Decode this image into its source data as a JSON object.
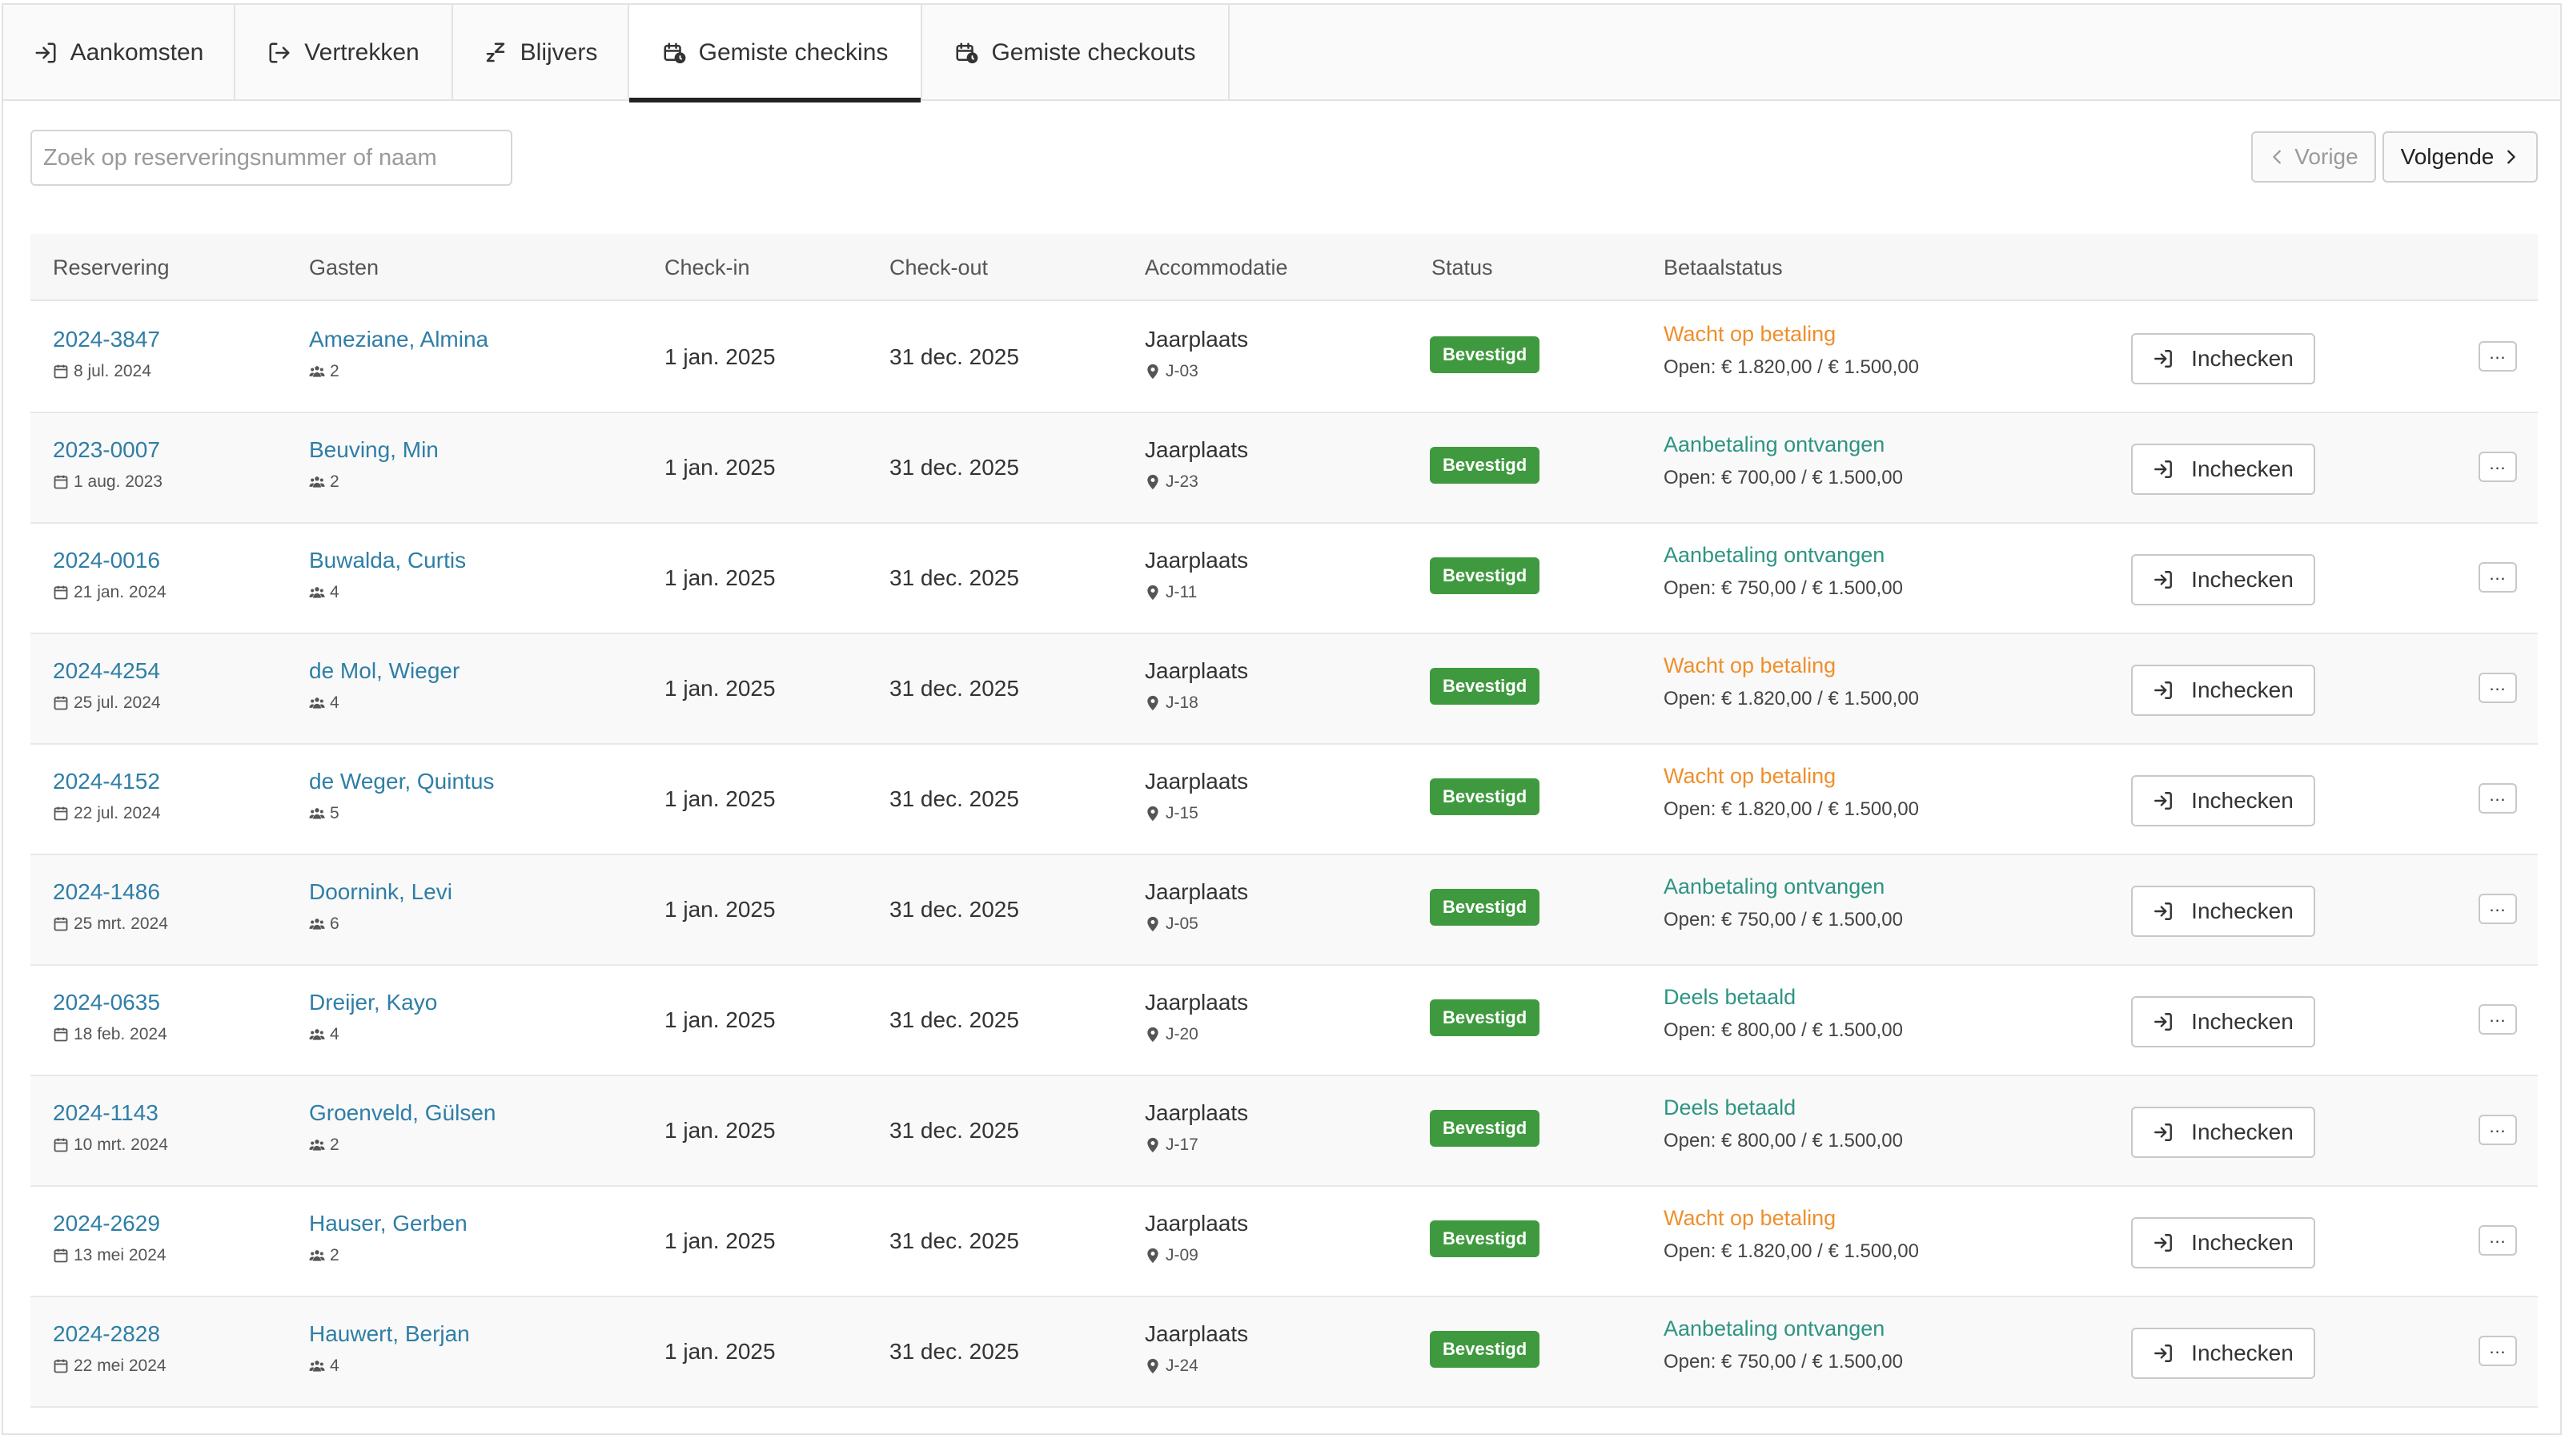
{
  "tabs": [
    {
      "label": "Aankomsten",
      "icon": "sign-in-icon"
    },
    {
      "label": "Vertrekken",
      "icon": "sign-out-icon"
    },
    {
      "label": "Blijvers",
      "icon": "sleep-icon"
    },
    {
      "label": "Gemiste checkins",
      "icon": "calendar-clock-icon",
      "active": true
    },
    {
      "label": "Gemiste checkouts",
      "icon": "calendar-clock-icon"
    }
  ],
  "search": {
    "placeholder": "Zoek op reserveringsnummer of naam"
  },
  "pager": {
    "prev_label": "Vorige",
    "next_label": "Volgende"
  },
  "table": {
    "headers": [
      "Reservering",
      "Gasten",
      "Check-in",
      "Check-out",
      "Accommodatie",
      "Status",
      "Betaalstatus"
    ],
    "action_label": "Inchecken",
    "rows": [
      {
        "res": "2024-3847",
        "date": "8 jul. 2024",
        "guest": "Ameziane, Almina",
        "count": "2",
        "checkin": "1 jan. 2025",
        "checkout": "31 dec. 2025",
        "acc": "Jaarplaats",
        "place": "J-03",
        "status": "Bevestigd",
        "pay": "Wacht op betaling",
        "pay_type": "waiting",
        "open": "Open: € 1.820,00 / € 1.500,00"
      },
      {
        "res": "2023-0007",
        "date": "1 aug. 2023",
        "guest": "Beuving, Min",
        "count": "2",
        "checkin": "1 jan. 2025",
        "checkout": "31 dec. 2025",
        "acc": "Jaarplaats",
        "place": "J-23",
        "status": "Bevestigd",
        "pay": "Aanbetaling ontvangen",
        "pay_type": "received",
        "open": "Open: € 700,00 / € 1.500,00"
      },
      {
        "res": "2024-0016",
        "date": "21 jan. 2024",
        "guest": "Buwalda, Curtis",
        "count": "4",
        "checkin": "1 jan. 2025",
        "checkout": "31 dec. 2025",
        "acc": "Jaarplaats",
        "place": "J-11",
        "status": "Bevestigd",
        "pay": "Aanbetaling ontvangen",
        "pay_type": "received",
        "open": "Open: € 750,00 / € 1.500,00"
      },
      {
        "res": "2024-4254",
        "date": "25 jul. 2024",
        "guest": "de Mol, Wieger",
        "count": "4",
        "checkin": "1 jan. 2025",
        "checkout": "31 dec. 2025",
        "acc": "Jaarplaats",
        "place": "J-18",
        "status": "Bevestigd",
        "pay": "Wacht op betaling",
        "pay_type": "waiting",
        "open": "Open: € 1.820,00 / € 1.500,00"
      },
      {
        "res": "2024-4152",
        "date": "22 jul. 2024",
        "guest": "de Weger, Quintus",
        "count": "5",
        "checkin": "1 jan. 2025",
        "checkout": "31 dec. 2025",
        "acc": "Jaarplaats",
        "place": "J-15",
        "status": "Bevestigd",
        "pay": "Wacht op betaling",
        "pay_type": "waiting",
        "open": "Open: € 1.820,00 / € 1.500,00"
      },
      {
        "res": "2024-1486",
        "date": "25 mrt. 2024",
        "guest": "Doornink, Levi",
        "count": "6",
        "checkin": "1 jan. 2025",
        "checkout": "31 dec. 2025",
        "acc": "Jaarplaats",
        "place": "J-05",
        "status": "Bevestigd",
        "pay": "Aanbetaling ontvangen",
        "pay_type": "received",
        "open": "Open: € 750,00 / € 1.500,00"
      },
      {
        "res": "2024-0635",
        "date": "18 feb. 2024",
        "guest": "Dreijer, Kayo",
        "count": "4",
        "checkin": "1 jan. 2025",
        "checkout": "31 dec. 2025",
        "acc": "Jaarplaats",
        "place": "J-20",
        "status": "Bevestigd",
        "pay": "Deels betaald",
        "pay_type": "partial",
        "open": "Open: € 800,00 / € 1.500,00"
      },
      {
        "res": "2024-1143",
        "date": "10 mrt. 2024",
        "guest": "Groenveld, Gülsen",
        "count": "2",
        "checkin": "1 jan. 2025",
        "checkout": "31 dec. 2025",
        "acc": "Jaarplaats",
        "place": "J-17",
        "status": "Bevestigd",
        "pay": "Deels betaald",
        "pay_type": "partial",
        "open": "Open: € 800,00 / € 1.500,00"
      },
      {
        "res": "2024-2629",
        "date": "13 mei 2024",
        "guest": "Hauser, Gerben",
        "count": "2",
        "checkin": "1 jan. 2025",
        "checkout": "31 dec. 2025",
        "acc": "Jaarplaats",
        "place": "J-09",
        "status": "Bevestigd",
        "pay": "Wacht op betaling",
        "pay_type": "waiting",
        "open": "Open: € 1.820,00 / € 1.500,00"
      },
      {
        "res": "2024-2828",
        "date": "22 mei 2024",
        "guest": "Hauwert, Berjan",
        "count": "4",
        "checkin": "1 jan. 2025",
        "checkout": "31 dec. 2025",
        "acc": "Jaarplaats",
        "place": "J-24",
        "status": "Bevestigd",
        "pay": "Aanbetaling ontvangen",
        "pay_type": "received",
        "open": "Open: € 750,00 / € 1.500,00"
      }
    ]
  },
  "colors": {
    "link": "#2f7ea6",
    "badge": "#3f9a3f",
    "pay_waiting": "#ee8f2c",
    "pay_received": "#2e9482"
  }
}
